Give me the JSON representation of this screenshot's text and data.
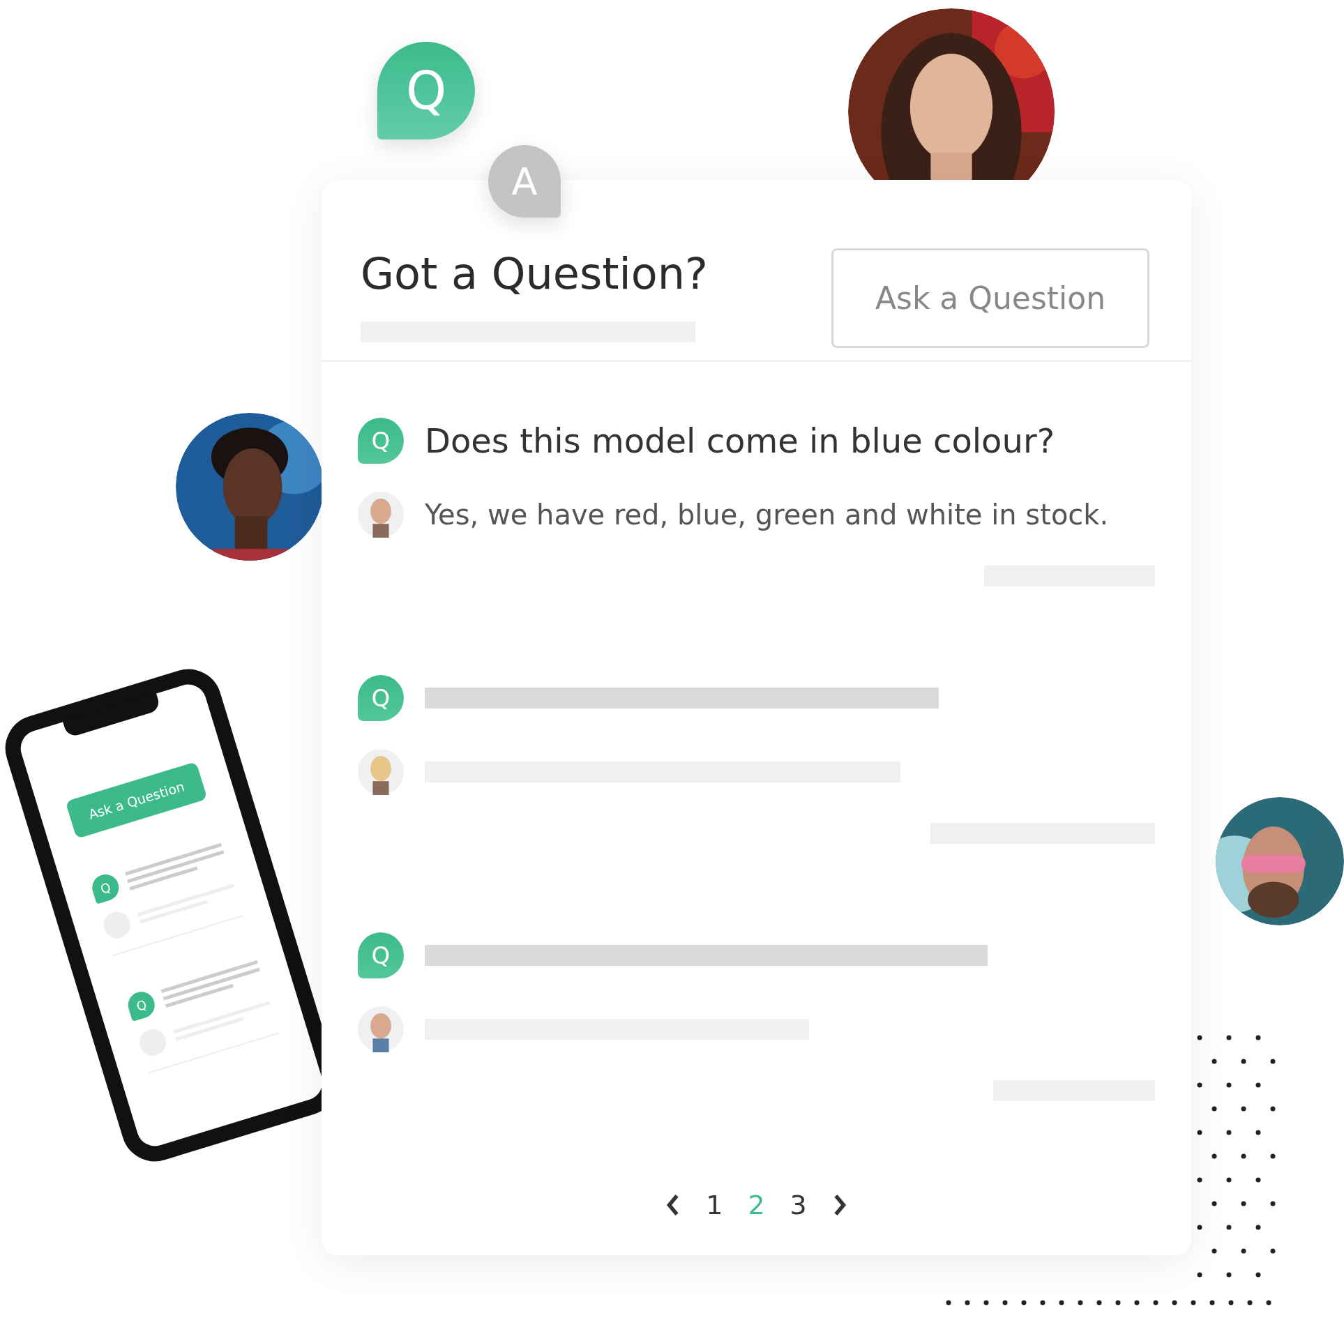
{
  "floating_bubbles": [
    {
      "kind": "question",
      "letter": "Q"
    },
    {
      "kind": "answer",
      "letter": "A"
    }
  ],
  "header": {
    "title": "Got a Question?",
    "button": "Ask a Question"
  },
  "questions": [
    {
      "kind": "text",
      "badge": "Q",
      "question": "Does this model come in blue colour?",
      "answer": "Yes, we have red, blue, green and white in stock."
    },
    {
      "kind": "skeleton",
      "badge": "Q"
    },
    {
      "kind": "skeleton",
      "badge": "Q"
    }
  ],
  "pagination": [
    {
      "label": "1",
      "selected": false
    },
    {
      "label": "2",
      "selected": true
    },
    {
      "label": "3",
      "selected": false
    }
  ],
  "phone": {
    "button": "Ask a Question",
    "badges": [
      "Q",
      "Q"
    ]
  }
}
